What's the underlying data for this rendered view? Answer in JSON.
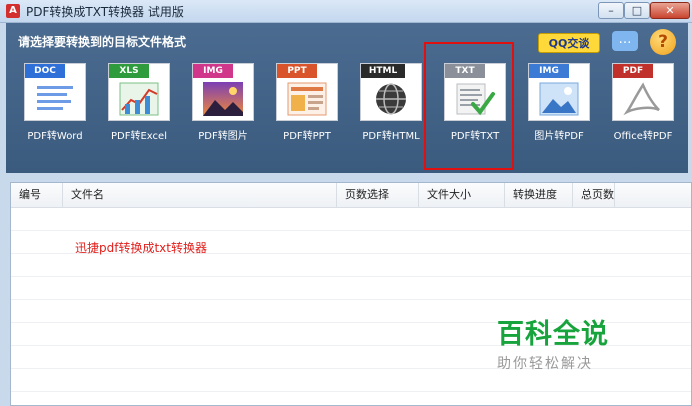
{
  "window": {
    "app_icon_glyph": "A",
    "title": "PDF转换成TXT转换器 试用版",
    "min_glyph": "–",
    "max_glyph": "□",
    "close_glyph": "✕"
  },
  "toolbar": {
    "title": "请选择要转换到的目标文件格式",
    "qq_label": "QQ交谈",
    "chat_icon_glyph": "…",
    "help_icon_glyph": "?",
    "buttons": [
      {
        "tag": "DOC",
        "label": "PDF转Word",
        "tag_color": "#2f6fd8"
      },
      {
        "tag": "XLS",
        "label": "PDF转Excel",
        "tag_color": "#2e9b3c"
      },
      {
        "tag": "IMG",
        "label": "PDF转图片",
        "tag_color": "#d0368a"
      },
      {
        "tag": "PPT",
        "label": "PDF转PPT",
        "tag_color": "#d9542a"
      },
      {
        "tag": "HTML",
        "label": "PDF转HTML",
        "tag_color": "#2a2a2a"
      },
      {
        "tag": "TXT",
        "label": "PDF转TXT",
        "tag_color": "#8a8f99"
      },
      {
        "tag": "IMG",
        "label": "图片转PDF",
        "tag_color": "#3b7bd6"
      },
      {
        "tag": "PDF",
        "label": "Office转PDF",
        "tag_color": "#c0312b"
      }
    ]
  },
  "table": {
    "columns": [
      "编号",
      "文件名",
      "页数选择",
      "文件大小",
      "转换进度",
      "总页数"
    ],
    "promo_text": "迅捷pdf转换成txt转换器"
  },
  "watermark": {
    "title": "百科全说",
    "subtitle": "助你轻松解决"
  }
}
